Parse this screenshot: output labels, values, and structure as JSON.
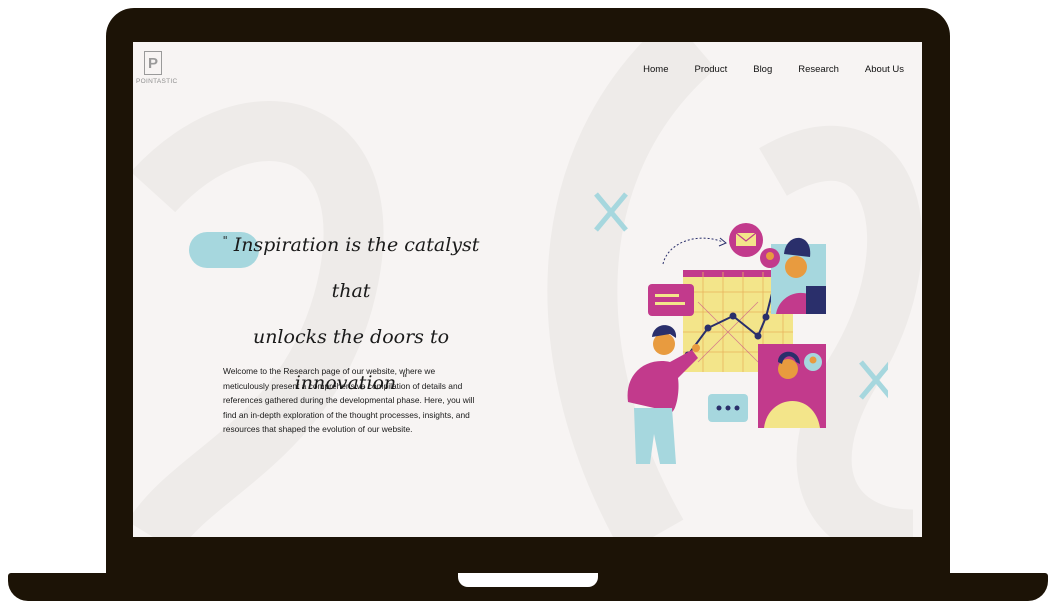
{
  "logo": {
    "letter": "P",
    "text": "POINTASTIC"
  },
  "nav": [
    "Home",
    "Product",
    "Blog",
    "Research",
    "About Us"
  ],
  "quote": {
    "open": "\"",
    "line1": "Inspiration is the catalyst that",
    "line2": "unlocks the doors to innovation",
    "close": "\""
  },
  "intro": "Welcome to the Research page of our website, where we meticulously present a comprehensive compilation of details and references gathered during the developmental phase. Here, you will find an in-depth exploration of the thought processes, insights, and resources that shaped the evolution of our website.",
  "colors": {
    "frame": "#1c1306",
    "screen": "#f7f4f3",
    "accent_teal": "#a6d7de",
    "accent_magenta": "#c23a8c",
    "accent_yellow": "#f3e58a",
    "navy": "#2a2f6b"
  }
}
